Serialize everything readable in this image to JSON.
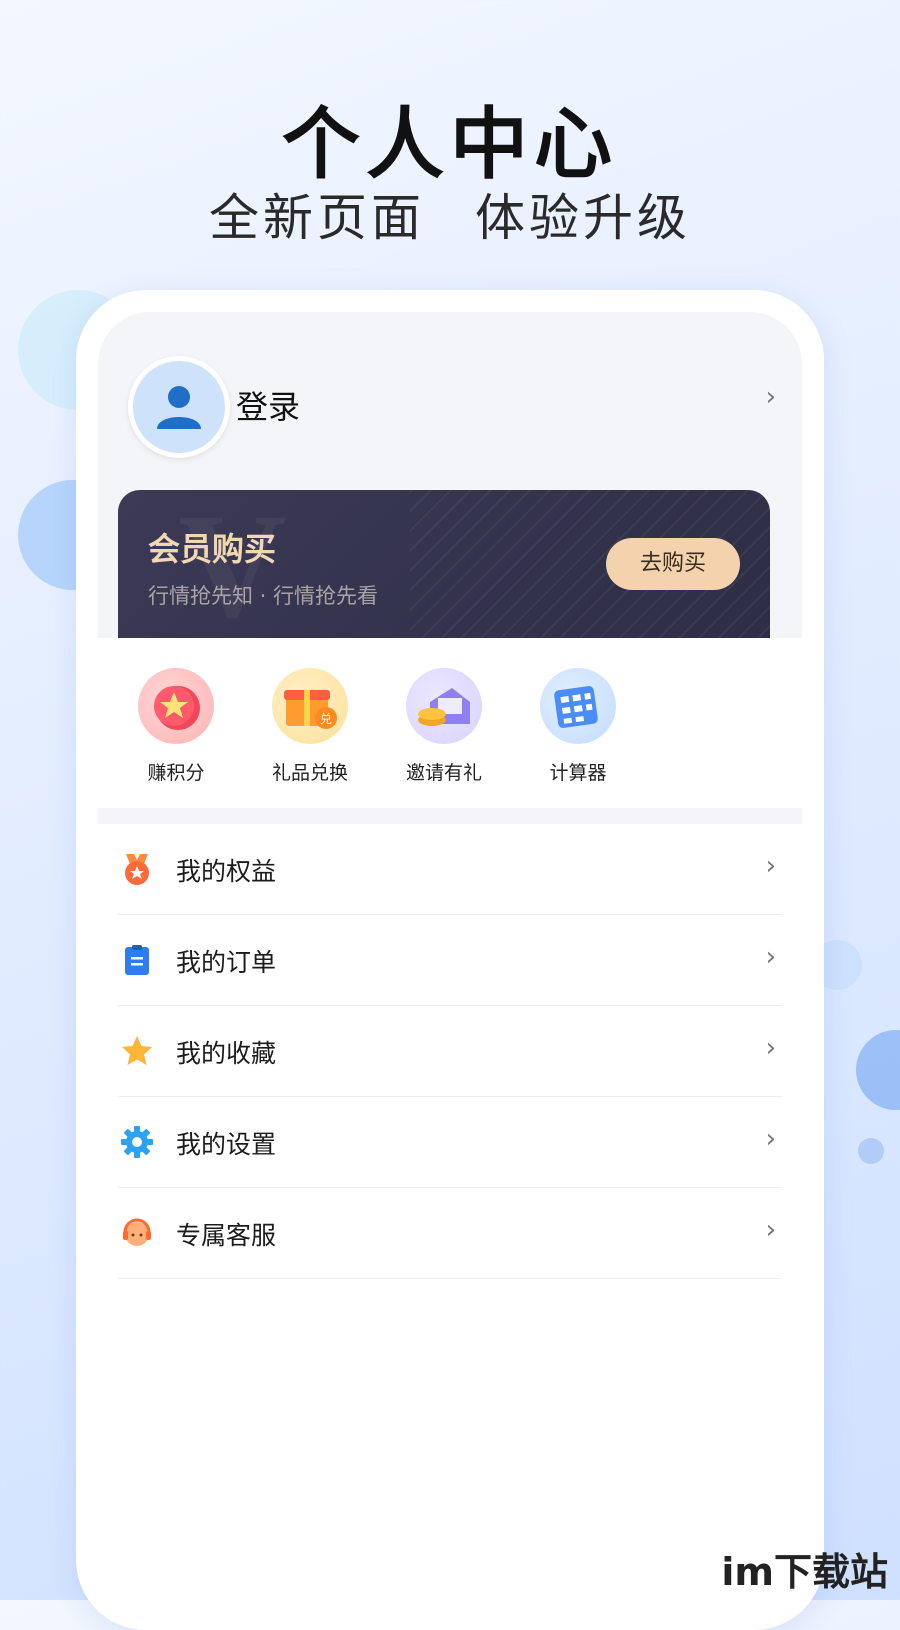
{
  "promo": {
    "title": "个人中心",
    "subtitle": "全新页面  体验升级"
  },
  "profile": {
    "login_label": "登录",
    "chevron": "›"
  },
  "vip": {
    "watermark": "V",
    "title": "会员购买",
    "subtitle": "行情抢先知 · 行情抢先看",
    "button_label": "去购买"
  },
  "quick_actions": [
    {
      "label": "赚积分",
      "icon": "star-badge-icon"
    },
    {
      "label": "礼品兑换",
      "icon": "gift-box-icon"
    },
    {
      "label": "邀请有礼",
      "icon": "invite-coins-icon"
    },
    {
      "label": "计算器",
      "icon": "calculator-icon"
    }
  ],
  "menu": [
    {
      "label": "我的权益",
      "icon": "medal-icon"
    },
    {
      "label": "我的订单",
      "icon": "clipboard-icon"
    },
    {
      "label": "我的收藏",
      "icon": "star-icon"
    },
    {
      "label": "我的设置",
      "icon": "gear-icon"
    },
    {
      "label": "专属客服",
      "icon": "headset-agent-icon"
    }
  ],
  "chevron": "›",
  "site_watermark": "im下载站",
  "colors": {
    "vip_bg": "#33334d",
    "vip_accent": "#f3d2ad",
    "page_bg": "#e6efff"
  }
}
